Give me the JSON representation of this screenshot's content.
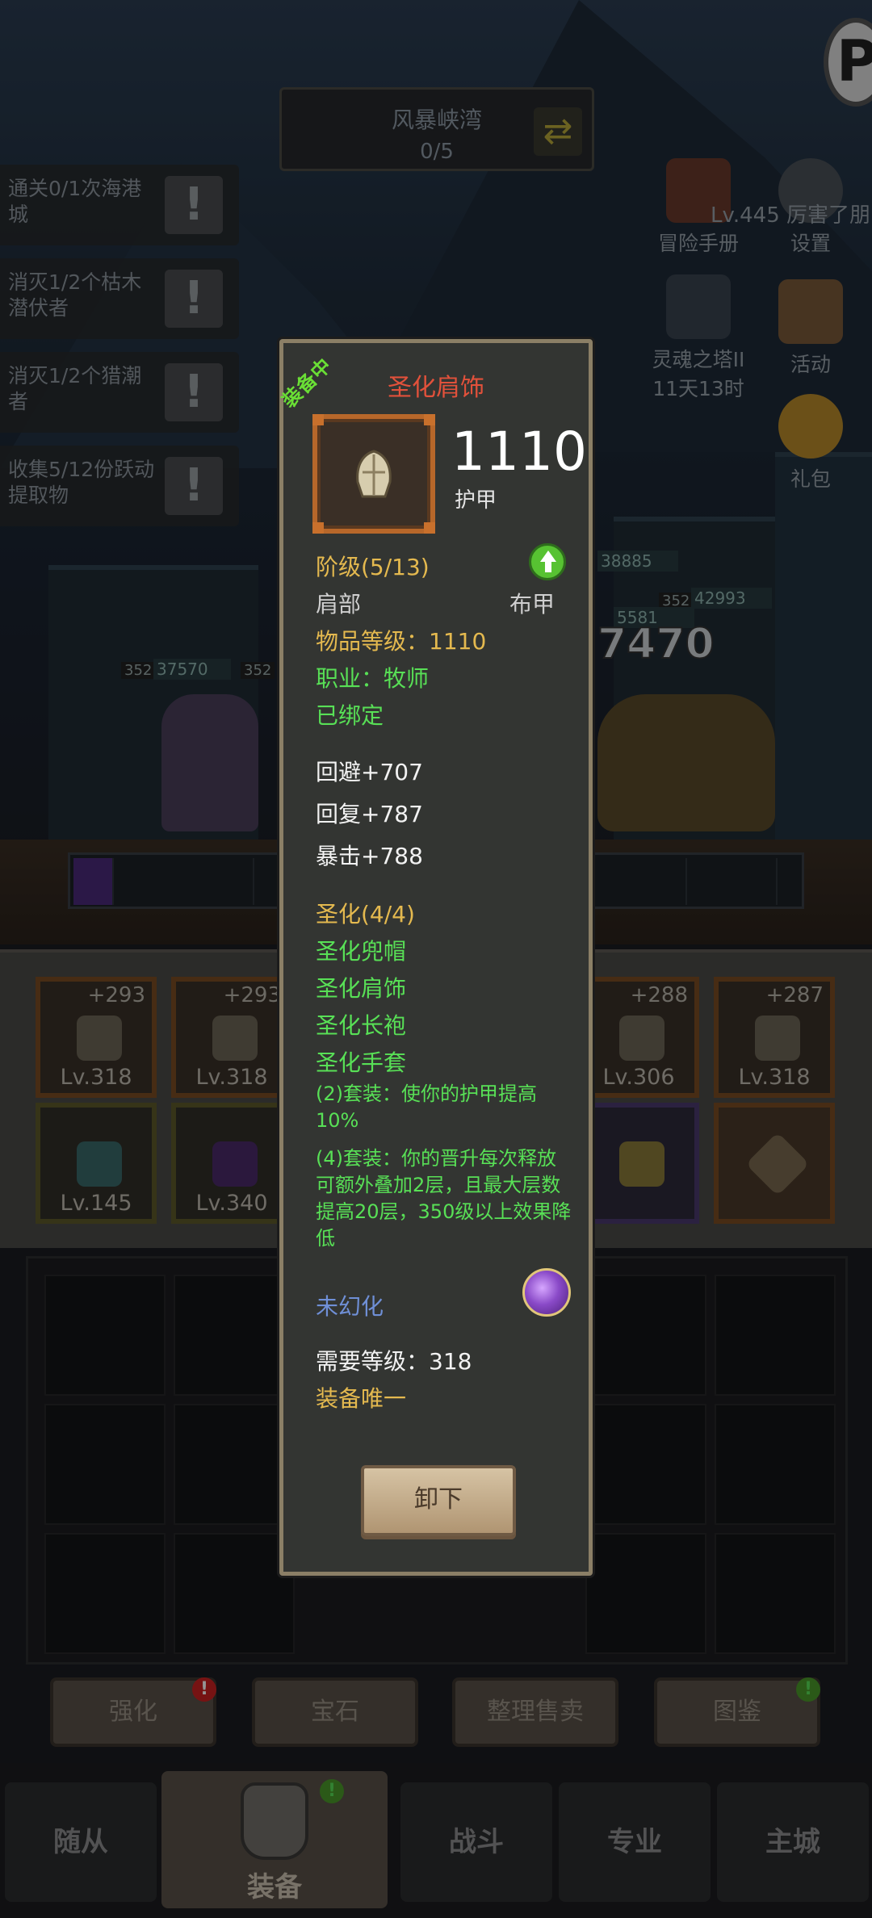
{
  "quest_header": {
    "title": "风暴峡湾",
    "progress": "0/5"
  },
  "quests": [
    {
      "text": "通关0/1次海港城"
    },
    {
      "text": "消灭1/2个枯木潜伏者"
    },
    {
      "text": "消灭1/2个猎潮者"
    },
    {
      "text": "收集5/12份跃动提取物"
    }
  ],
  "side_menu": {
    "adventure_handbook": "冒险手册",
    "settings": "设置",
    "level_text": "Lv.445 厉害了朋",
    "soul_tower": "灵魂之塔II",
    "soul_tower_timer": "11天13时",
    "events": "活动",
    "gift": "礼包"
  },
  "battle": {
    "ally_hp": "37570",
    "ally_level": "352",
    "ally_level_2": "352",
    "enemy_hp_1": "38885",
    "enemy_hp_2": "42993",
    "enemy_level": "352",
    "enemy_hp_partial": "5581",
    "damage_number": "7470"
  },
  "equipment_slots": [
    {
      "plus": "+293",
      "level": "Lv.318"
    },
    {
      "plus": "+293",
      "level": "Lv.318"
    },
    {
      "plus": "+288",
      "level": "Lv.306"
    },
    {
      "plus": "+287",
      "level": "Lv.318"
    },
    {
      "level": "Lv.145"
    },
    {
      "level": "Lv.340"
    }
  ],
  "actions": {
    "enhance": "强化",
    "gems": "宝石",
    "sort_sell": "整理售卖",
    "codex": "图鉴",
    "enhance_badge": "!",
    "codex_badge": "!"
  },
  "nav": {
    "followers": "随从",
    "equipment": "装备",
    "battle": "战斗",
    "profession": "专业",
    "main_city": "主城",
    "equipment_badge": "!"
  },
  "tooltip": {
    "equipped_label": "装备中",
    "item_name": "圣化肩饰",
    "score": "1110",
    "score_type": "护甲",
    "tier": "阶级(5/13)",
    "slot": "肩部",
    "armor_type": "布甲",
    "item_level": "物品等级：1110",
    "class": "职业：牧师",
    "bound": "已绑定",
    "stats": [
      "回避+707",
      "回复+787",
      "暴击+788"
    ],
    "set_name": "圣化(4/4)",
    "set_items": [
      "圣化兜帽",
      "圣化肩饰",
      "圣化长袍",
      "圣化手套"
    ],
    "set_bonus_2": "(2)套装：使你的护甲提高10%",
    "set_bonus_4": "(4)套装：你的晋升每次释放可额外叠加2层，且最大层数提高20层，350级以上效果降低",
    "transmog": "未幻化",
    "required_level": "需要等级：318",
    "unique": "装备唯一",
    "unequip": "卸下"
  },
  "colors": {
    "item_name": "#e2513b",
    "gold_text": "#e4b94f",
    "green_text": "#58e056",
    "blue_text": "#6f8fd6",
    "card_border": "#8b7f66"
  }
}
